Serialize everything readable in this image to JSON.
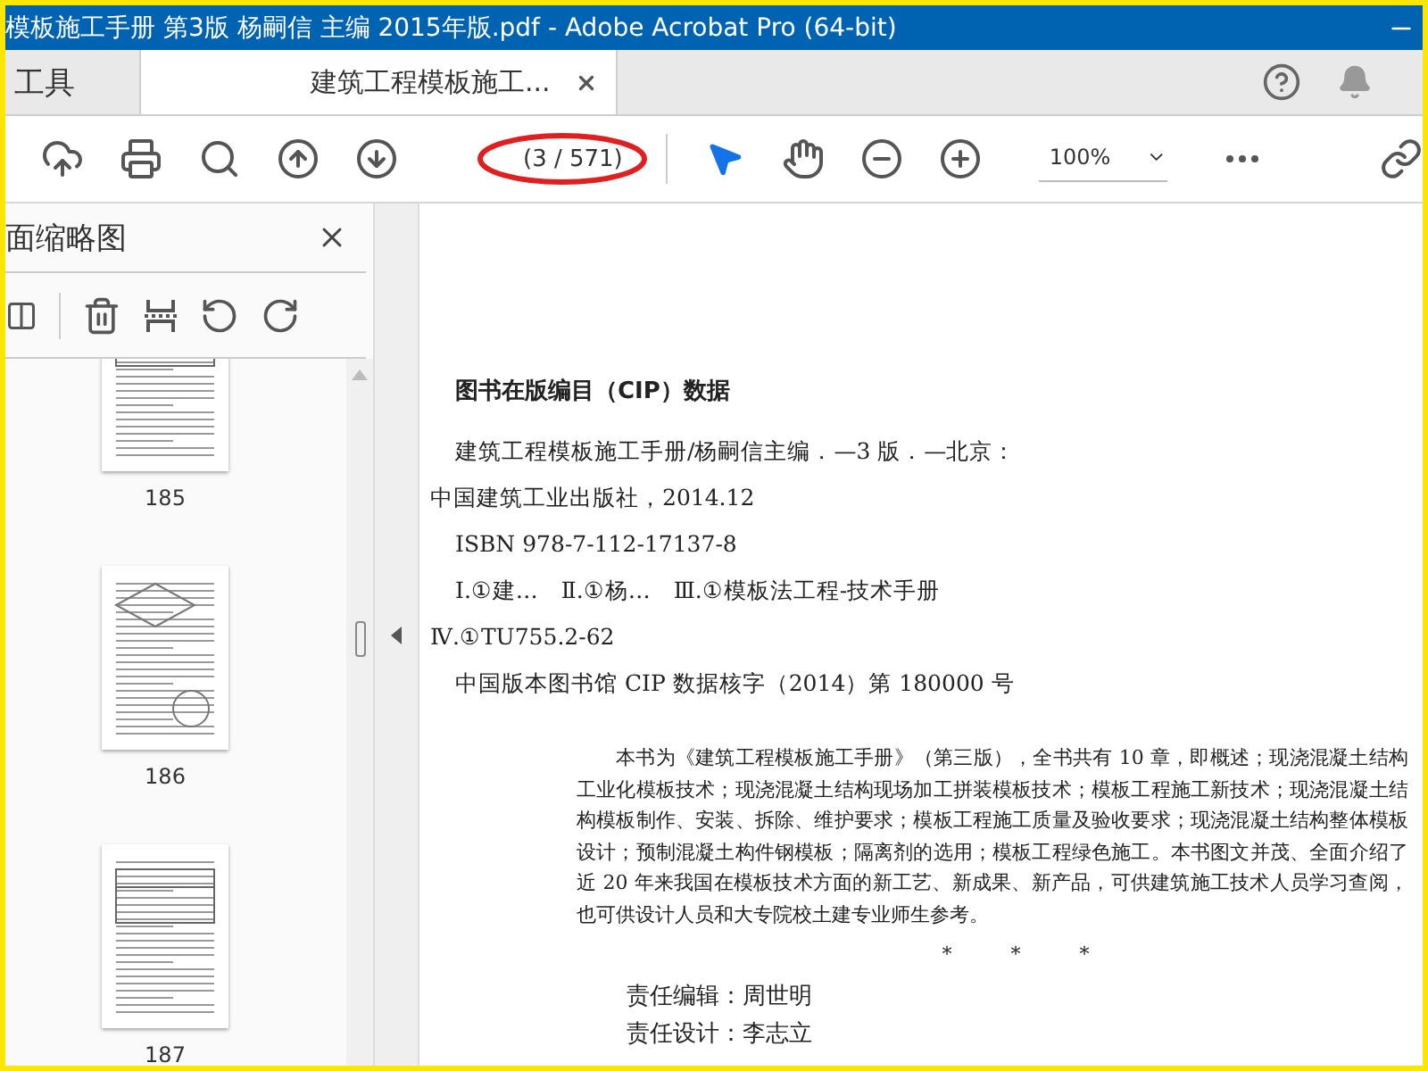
{
  "window": {
    "title": "模板施工手册 第3版 杨嗣信 主编 2015年版.pdf - Adobe Acrobat Pro (64-bit)"
  },
  "tabs": [
    {
      "label": "工具",
      "selected": false
    },
    {
      "label": "建筑工程模板施工...",
      "selected": true
    }
  ],
  "toolbar": {
    "page_indicator": "(3 / 571)",
    "zoom": "100%"
  },
  "sidebar": {
    "title": "面缩略图",
    "thumbnails": [
      {
        "label": "185",
        "kind": "table"
      },
      {
        "label": "186",
        "kind": "figure"
      },
      {
        "label": "187",
        "kind": "table"
      }
    ]
  },
  "document": {
    "heading": "图书在版编目（CIP）数据",
    "cip_lines": [
      {
        "text": "建筑工程模板施工手册/杨嗣信主编．—3 版．—北京：",
        "indent": true
      },
      {
        "text": "中国建筑工业出版社，2014.12",
        "indent": false
      },
      {
        "text": "ISBN 978-7-112-17137-8",
        "indent": true
      },
      {
        "text": "Ⅰ.①建…　Ⅱ.①杨…　Ⅲ.①模板法工程-技术手册",
        "indent": true
      },
      {
        "text": "Ⅳ.①TU755.2-62",
        "indent": false
      },
      {
        "text": "中国版本图书馆 CIP 数据核字（2014）第 180000 号",
        "indent": true
      }
    ],
    "summary": "本书为《建筑工程模板施工手册》（第三版），全书共有 10 章，即概述；现浇混凝土结构工业化模板技术；现浇混凝土结构现场加工拼装模板技术；模板工程施工新技术；现浇混凝土结构模板制作、安装、拆除、维护要求；模板工程施工质量及验收要求；现浇混凝土结构整体模板设计；预制混凝土构件钢模板；隔离剂的选用；模板工程绿色施工。本书图文并茂、全面介绍了近 20 年来我国在模板技术方面的新工艺、新成果、新产品，可供建筑施工技术人员学习查阅，也可供设计人员和大专院校土建专业师生参考。",
    "separator": "*　　　*　　　*",
    "credits": [
      "责任编辑：周世明",
      "责任设计：李志立"
    ]
  }
}
